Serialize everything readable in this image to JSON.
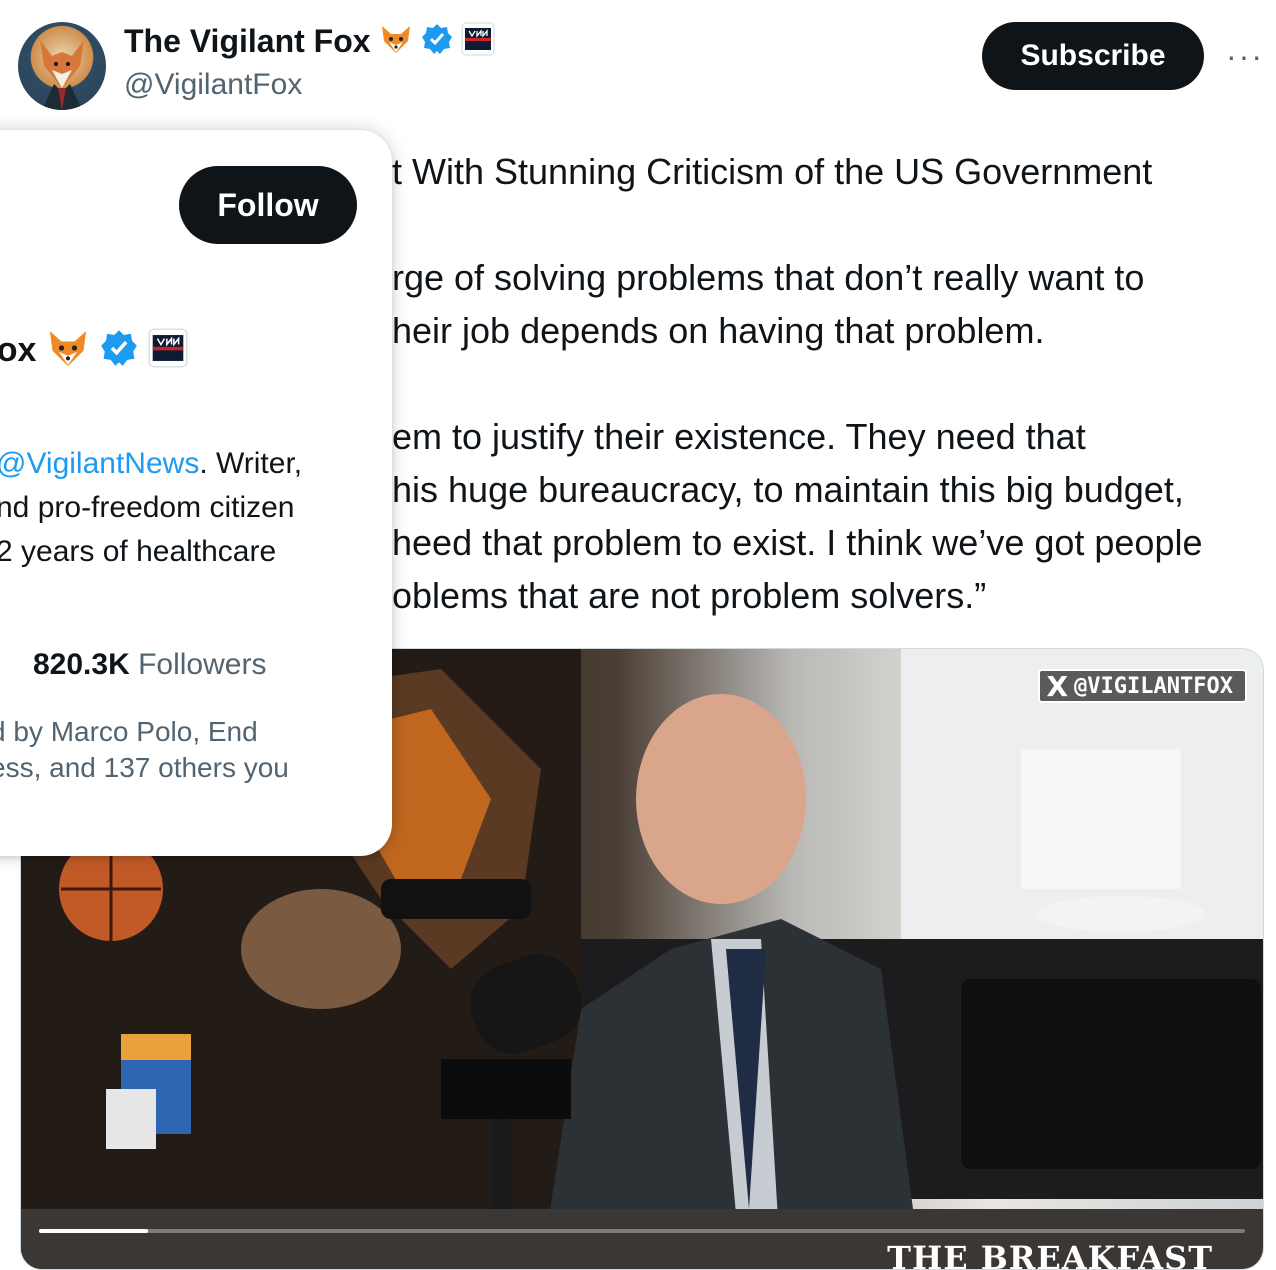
{
  "author": {
    "name": "The Vigilant Fox",
    "handle": "@VigilantFox"
  },
  "actions": {
    "subscribe_label": "Subscribe",
    "more_label": "···"
  },
  "tweet": {
    "lines_1": [
      "t With Stunning Criticism of the US Government"
    ],
    "lines_2": [
      "rge of solving problems that don’t really want to",
      "heir job depends on having that problem."
    ],
    "lines_3": [
      "em to justify their existence. They need that",
      "his huge bureaucracy, to maintain this big budget,",
      "heed that problem to exist. I think we’ve got people",
      "oblems that are not problem solvers.”"
    ]
  },
  "video": {
    "watermark_handle": "@VIGILANTFOX",
    "watermark_x": "X",
    "bottom_brand": "THE BREAKFAST",
    "progress_fraction": 0.09
  },
  "hovercard": {
    "follow_label": "Follow",
    "name_partial": "Fox",
    "bio_link": "@VigilantNews",
    "bio_line1_suffix": ". Writer,",
    "bio_line2": "nd pro-freedom citizen",
    "bio_line3": "2 years of healthcare",
    "followers_count": "820.3K",
    "followers_label": "Followers",
    "mutual_line1": "d by Marco Polo, End",
    "mutual_line2": "ess, and 137 others you"
  },
  "colors": {
    "link": "#1d9bf0",
    "button_bg": "#0f1419",
    "secondary_text": "#536471"
  }
}
